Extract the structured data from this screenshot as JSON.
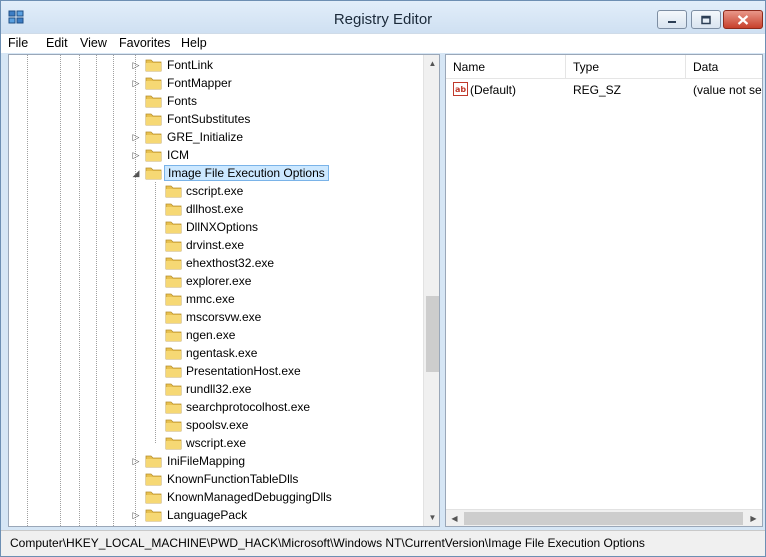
{
  "window": {
    "title": "Registry Editor"
  },
  "menu": [
    "File",
    "Edit",
    "View",
    "Favorites",
    "Help"
  ],
  "tree": {
    "items": [
      {
        "label": "FontLink",
        "level": 1,
        "expander": "collapsed"
      },
      {
        "label": "FontMapper",
        "level": 1,
        "expander": "collapsed"
      },
      {
        "label": "Fonts",
        "level": 1,
        "expander": "none"
      },
      {
        "label": "FontSubstitutes",
        "level": 1,
        "expander": "none"
      },
      {
        "label": "GRE_Initialize",
        "level": 1,
        "expander": "collapsed"
      },
      {
        "label": "ICM",
        "level": 1,
        "expander": "collapsed"
      },
      {
        "label": "Image File Execution Options",
        "level": 1,
        "expander": "expanded",
        "selected": true
      },
      {
        "label": "cscript.exe",
        "level": 2,
        "expander": "none"
      },
      {
        "label": "dllhost.exe",
        "level": 2,
        "expander": "none"
      },
      {
        "label": "DllNXOptions",
        "level": 2,
        "expander": "none"
      },
      {
        "label": "drvinst.exe",
        "level": 2,
        "expander": "none"
      },
      {
        "label": "ehexthost32.exe",
        "level": 2,
        "expander": "none"
      },
      {
        "label": "explorer.exe",
        "level": 2,
        "expander": "none"
      },
      {
        "label": "mmc.exe",
        "level": 2,
        "expander": "none"
      },
      {
        "label": "mscorsvw.exe",
        "level": 2,
        "expander": "none"
      },
      {
        "label": "ngen.exe",
        "level": 2,
        "expander": "none"
      },
      {
        "label": "ngentask.exe",
        "level": 2,
        "expander": "none"
      },
      {
        "label": "PresentationHost.exe",
        "level": 2,
        "expander": "none"
      },
      {
        "label": "rundll32.exe",
        "level": 2,
        "expander": "none"
      },
      {
        "label": "searchprotocolhost.exe",
        "level": 2,
        "expander": "none"
      },
      {
        "label": "spoolsv.exe",
        "level": 2,
        "expander": "none"
      },
      {
        "label": "wscript.exe",
        "level": 2,
        "expander": "none"
      },
      {
        "label": "IniFileMapping",
        "level": 1,
        "expander": "collapsed"
      },
      {
        "label": "KnownFunctionTableDlls",
        "level": 1,
        "expander": "none"
      },
      {
        "label": "KnownManagedDebuggingDlls",
        "level": 1,
        "expander": "none"
      },
      {
        "label": "LanguagePack",
        "level": 1,
        "expander": "collapsed"
      }
    ],
    "scroll_position": 0.62
  },
  "list": {
    "columns": [
      "Name",
      "Type",
      "Data"
    ],
    "rows": [
      {
        "icon": "string-value-icon",
        "name": "(Default)",
        "type": "REG_SZ",
        "data": "(value not set)"
      }
    ]
  },
  "statusbar": {
    "path": "Computer\\HKEY_LOCAL_MACHINE\\PWD_HACK\\Microsoft\\Windows NT\\CurrentVersion\\Image File Execution Options"
  },
  "colors": {
    "selection": "#cce8ff",
    "folder": "#e8c14f",
    "titlebar": "#d6e6f5"
  }
}
